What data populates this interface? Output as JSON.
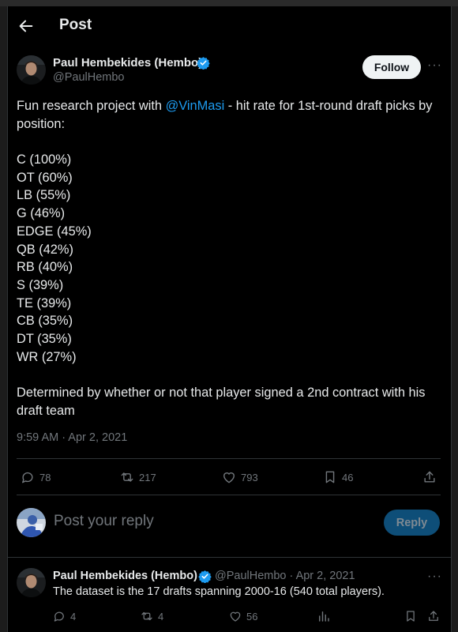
{
  "header": {
    "title": "Post"
  },
  "post": {
    "author_name": "Paul Hembekides (Hembo)",
    "author_handle": "@PaulHembo",
    "follow_label": "Follow",
    "more_label": "···",
    "intro_before": "Fun research project with ",
    "mention": "@VinMasi",
    "intro_after": " - hit rate for 1st-round draft picks by position:",
    "positions": [
      "C (100%)",
      "OT (60%)",
      "LB (55%)",
      "G (46%)",
      "EDGE (45%)",
      "QB (42%)",
      "RB (40%)",
      "S (39%)",
      "TE (39%)",
      "CB (35%)",
      "DT (35%)",
      "WR (27%)"
    ],
    "footer_text": "Determined by whether or not that player signed a 2nd contract with his draft team",
    "timestamp": "9:59 AM · Apr 2, 2021",
    "stats": {
      "replies": "78",
      "reposts": "217",
      "likes": "793",
      "bookmarks": "46"
    }
  },
  "composer": {
    "placeholder": "Post your reply",
    "reply_label": "Reply"
  },
  "reply": {
    "author_name": "Paul Hembekides (Hembo)",
    "handle_date": "@PaulHembo · Apr 2, 2021",
    "text": "The dataset is the 17 drafts spanning 2000-16 (540 total players).",
    "stats": {
      "replies": "4",
      "reposts": "4",
      "likes": "56"
    }
  },
  "colors": {
    "accent": "#1d9bf0",
    "background": "#000000",
    "muted": "#71767b"
  }
}
